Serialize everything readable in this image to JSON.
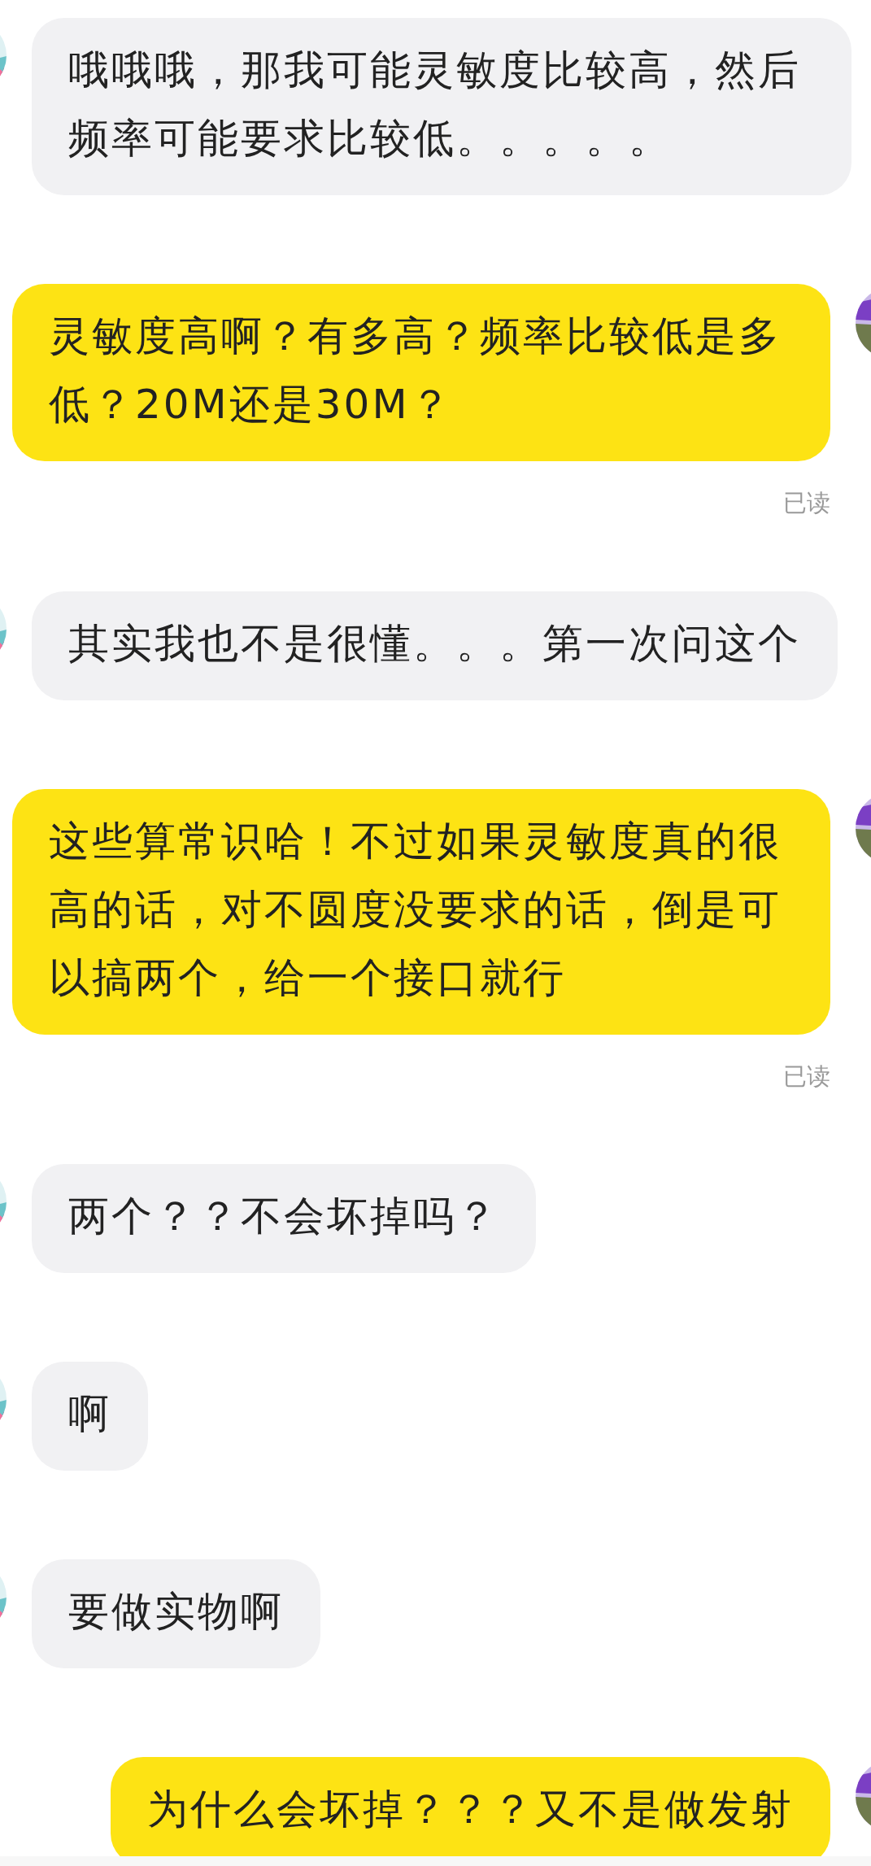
{
  "messages": [
    {
      "kind": "incoming",
      "text": "哦哦哦，那我可能灵敏度比较高，然后频率可能要求比较低。。。。。"
    },
    {
      "kind": "outgoing",
      "text": "灵敏度高啊？有多高？频率比较低是多低？20M还是30M？",
      "receipt": "已读"
    },
    {
      "kind": "incoming",
      "text": "其实我也不是很懂。。。第一次问这个"
    },
    {
      "kind": "outgoing",
      "text": "这些算常识哈！不过如果灵敏度真的很高的话，对不圆度没要求的话，倒是可以搞两个，给一个接口就行",
      "receipt": "已读"
    },
    {
      "kind": "incoming",
      "text": "两个？？不会坏掉吗？"
    },
    {
      "kind": "incoming",
      "text": "啊"
    },
    {
      "kind": "incoming",
      "text": "要做实物啊"
    },
    {
      "kind": "outgoing",
      "text": "为什么会坏掉？？？又不是做发射"
    }
  ]
}
